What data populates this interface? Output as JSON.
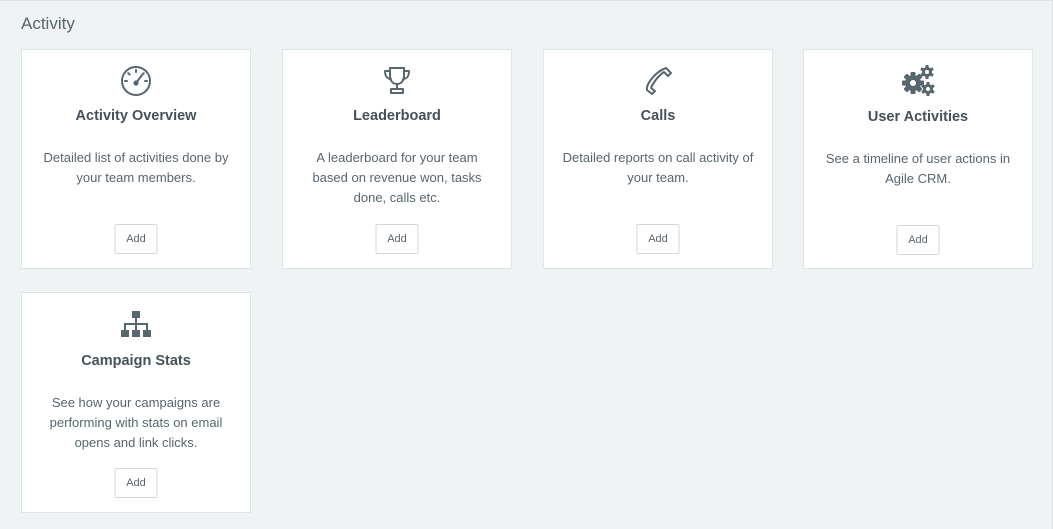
{
  "section": {
    "title": "Activity"
  },
  "cards": [
    {
      "icon": "speedometer-icon",
      "title": "Activity Overview",
      "description": "Detailed list of activities done by your team members.",
      "button": "Add"
    },
    {
      "icon": "trophy-icon",
      "title": "Leaderboard",
      "description": "A leaderboard for your team based on revenue won, tasks done, calls etc.",
      "button": "Add"
    },
    {
      "icon": "phone-icon",
      "title": "Calls",
      "description": "Detailed reports on call activity of your team.",
      "button": "Add"
    },
    {
      "icon": "gears-icon",
      "title": "User Activities",
      "description": "See a timeline of user actions in Agile CRM.",
      "button": "Add"
    },
    {
      "icon": "sitemap-icon",
      "title": "Campaign Stats",
      "description": "See how your campaigns are performing with stats on email opens and link clicks.",
      "button": "Add"
    }
  ]
}
